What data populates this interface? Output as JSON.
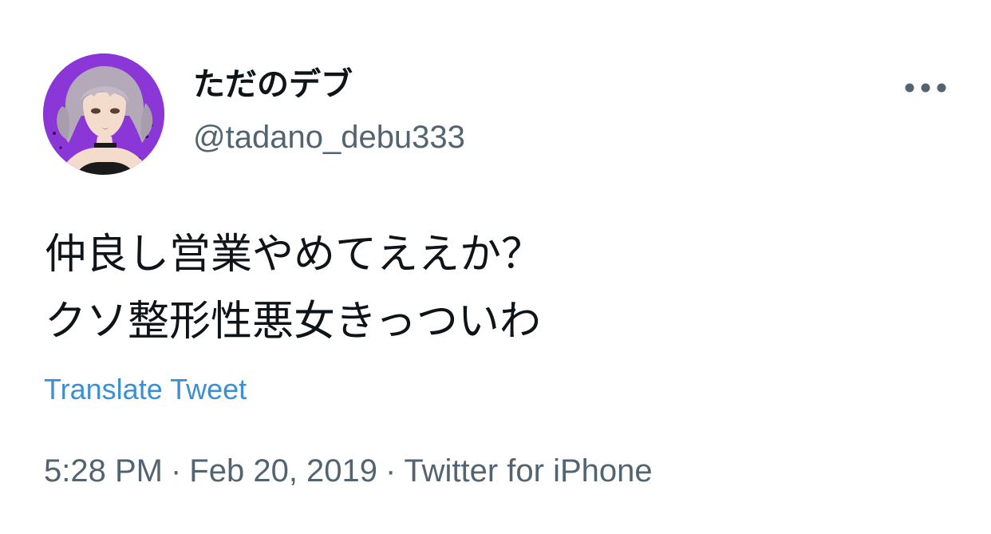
{
  "tweet": {
    "author": {
      "display_name": "ただのデブ",
      "handle": "@tadano_debu333",
      "avatar": "avatar-image"
    },
    "more_icon": "more-horizontal-icon",
    "text_lines": [
      "仲良し営業やめてええか？",
      "クソ整形性悪女きっついわ"
    ],
    "translate_label": "Translate Tweet",
    "time": "5:28 PM",
    "separator": "·",
    "date": "Feb 20, 2019",
    "source": "Twitter for iPhone"
  },
  "colors": {
    "text": "#0f1419",
    "secondary": "#536471",
    "link": "#3a8fd6",
    "avatar_background": "#8b36d6"
  }
}
